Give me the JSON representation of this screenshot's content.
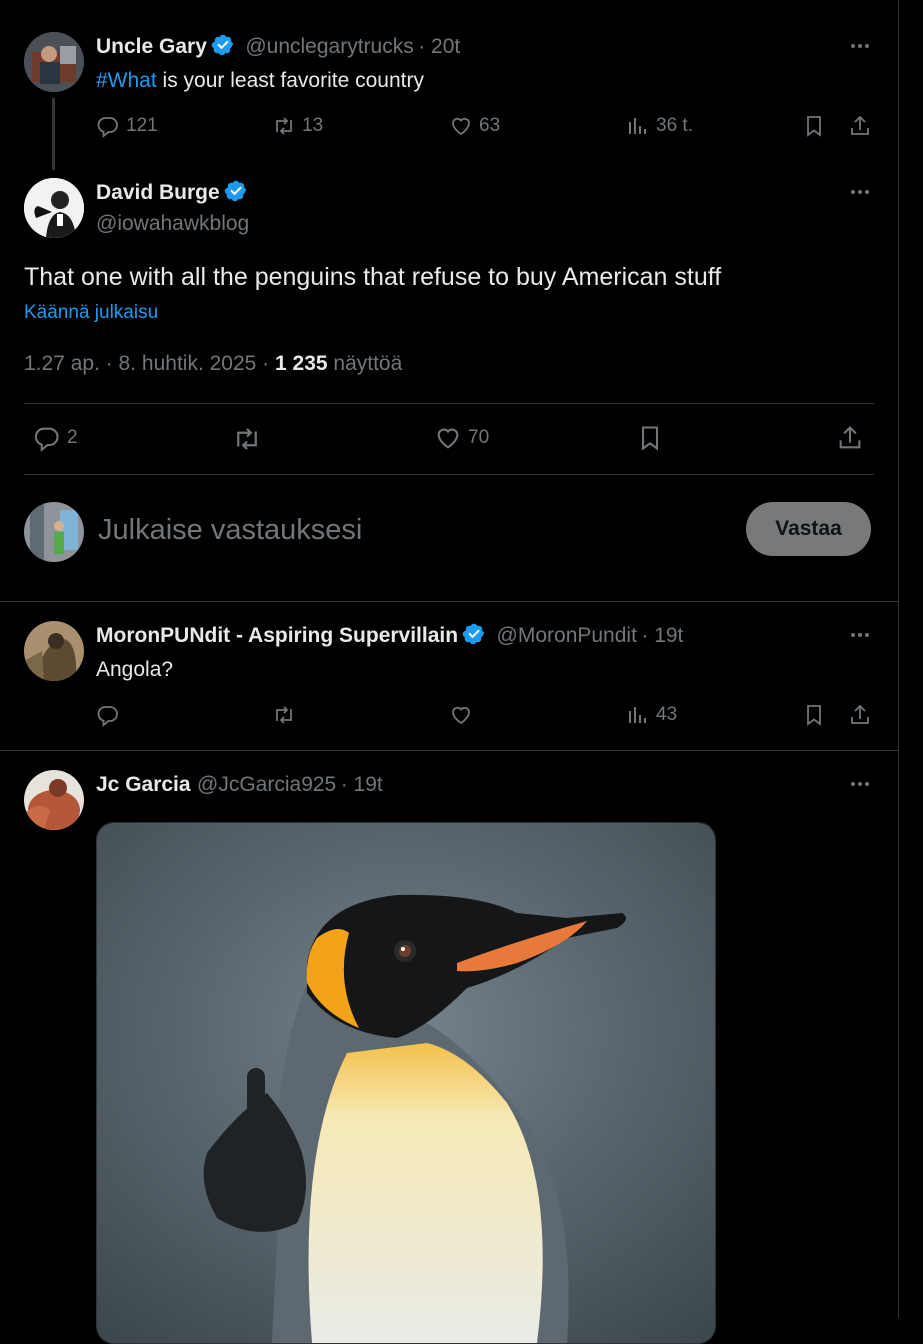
{
  "tweet1": {
    "name": "Uncle Gary",
    "handle": "@unclegarytrucks",
    "time": "· 20t",
    "hashtag": "#What",
    "text": " is your least favorite country",
    "replies": "121",
    "retweets": "13",
    "likes": "63",
    "views": "36 t."
  },
  "main": {
    "name": "David Burge",
    "handle": "@iowahawkblog",
    "text": "That one with all the penguins that refuse to buy American stuff",
    "translate": "Käännä julkaisu",
    "time_date": "1.27 ap. · 8. huhtik. 2025 · ",
    "view_count": "1 235",
    "views_label": " näyttöä",
    "replies": "2",
    "likes": "70"
  },
  "composer": {
    "placeholder": "Julkaise vastauksesi",
    "button": "Vastaa"
  },
  "reply1": {
    "name": "MoronPUNdit - Aspiring Supervillain",
    "handle": "@MoronPundit",
    "time": "· 19t",
    "text": "Angola?",
    "views": "43"
  },
  "reply2": {
    "name": "Jc Garcia",
    "handle": "@JcGarcia925",
    "time": "· 19t"
  },
  "colors": {
    "accent": "#1d9bf0",
    "background": "#000000",
    "muted": "#71767b",
    "text": "#e7e9ea"
  }
}
